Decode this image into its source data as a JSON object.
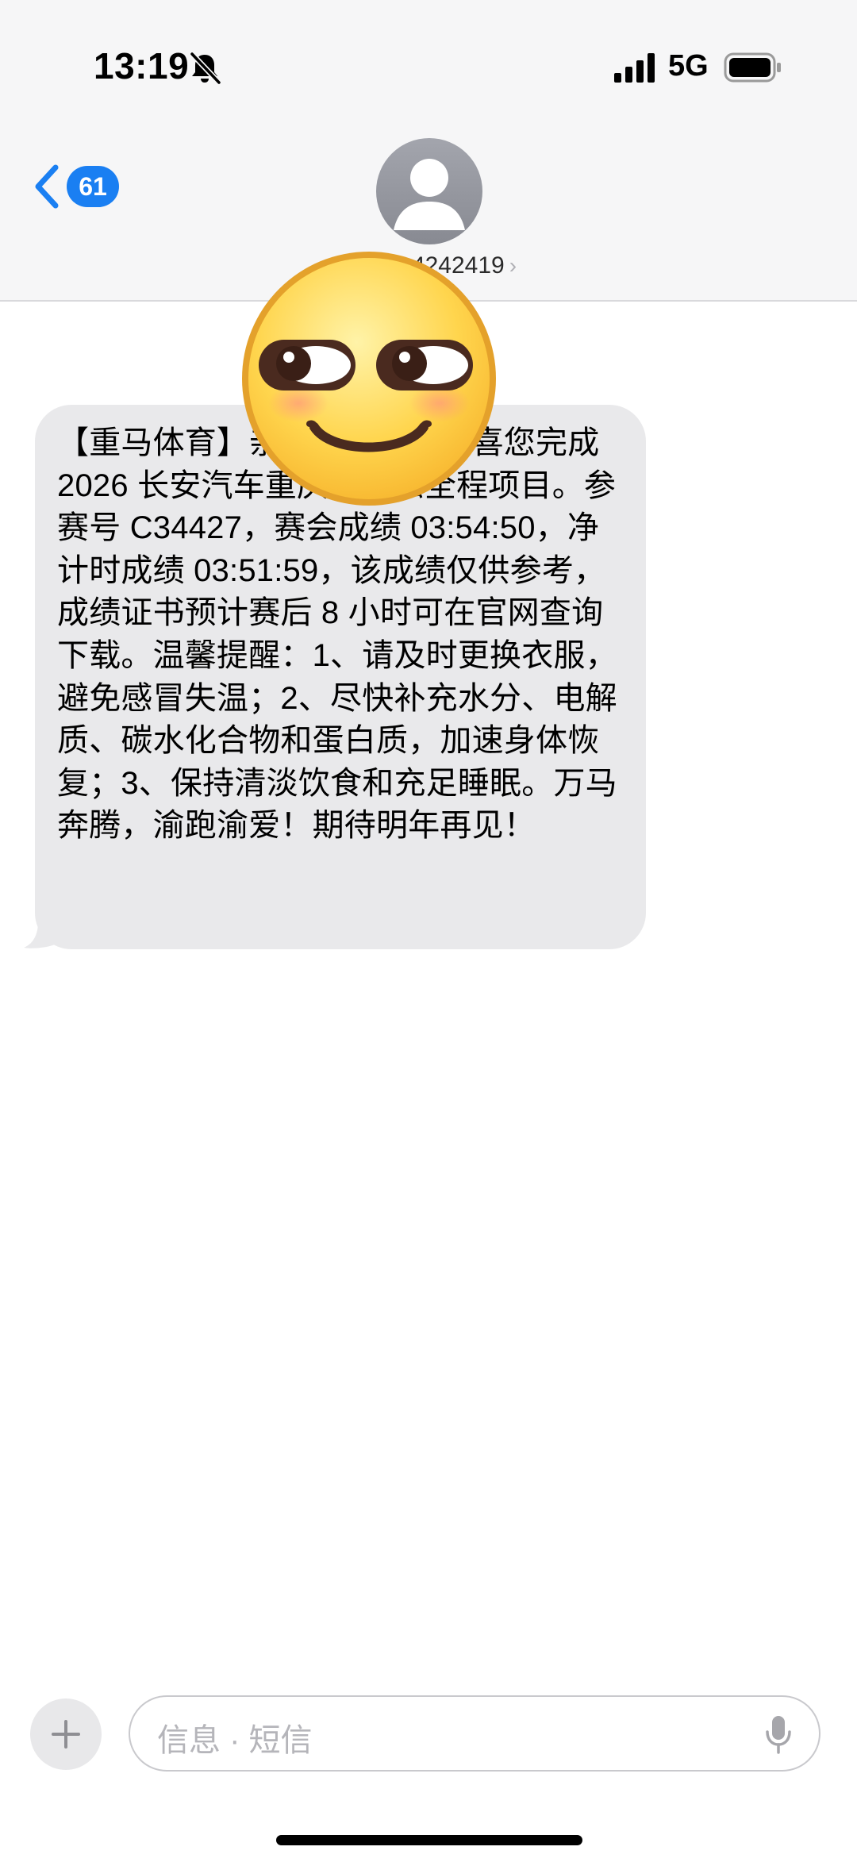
{
  "status_bar": {
    "time": "13:19",
    "network": "5G",
    "icons": [
      "bell-slash-icon",
      "signal-icon",
      "battery-icon"
    ]
  },
  "nav": {
    "back_icon": "chevron-left-icon",
    "unread_count": "61",
    "contact_name": "…4242419",
    "contact_chevron": "›",
    "avatar_icon": "person-icon",
    "accent_color": "#1a7ff2"
  },
  "sticker": {
    "icon": "smirking-face-sticker"
  },
  "message": {
    "text": "【重马体育】亲爱的跑友，恭喜您完成 2026 长安汽车重庆马拉松全程项目。参赛号 C34427，赛会成绩 03:54:50，净计时成绩 03:51:59，该成绩仅供参考，成绩证书预计赛后 8 小时可在官网查询下载。温馨提醒：1、请及时更换衣服，避免感冒失温；2、尽快补充水分、电解质、碳水化合物和蛋白质，加速身体恢复；3、保持清淡饮食和充足睡眠。万马奔腾，渝跑渝爱！期待明年再见！",
    "bubble_color": "#e9e9eb"
  },
  "composer": {
    "plus_label": "+",
    "placeholder": "信息 · 短信",
    "mic_icon": "microphone-icon"
  }
}
